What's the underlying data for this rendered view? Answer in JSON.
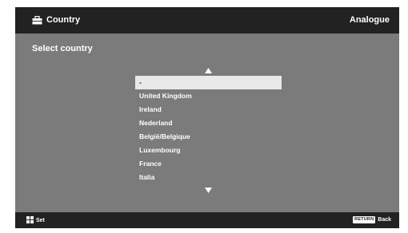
{
  "header": {
    "title": "Country",
    "mode": "Analogue",
    "icon": "toolbox-icon"
  },
  "subtitle": "Select country",
  "list": {
    "items": [
      "-",
      "United Kingdom",
      "Ireland",
      "Nederland",
      "België/Belgique",
      "Luxembourg",
      "France",
      "Italia"
    ],
    "selected_index": 0,
    "up_icon": "arrow-up-icon",
    "down_icon": "arrow-down-icon"
  },
  "footer": {
    "set_label": "Set",
    "set_icon": "dpad-icon",
    "return_key_label": "RETURN",
    "back_label": "Back"
  },
  "colors": {
    "background": "#7b7b7b",
    "bars": "#222222",
    "highlight": "#e9e9e9"
  }
}
